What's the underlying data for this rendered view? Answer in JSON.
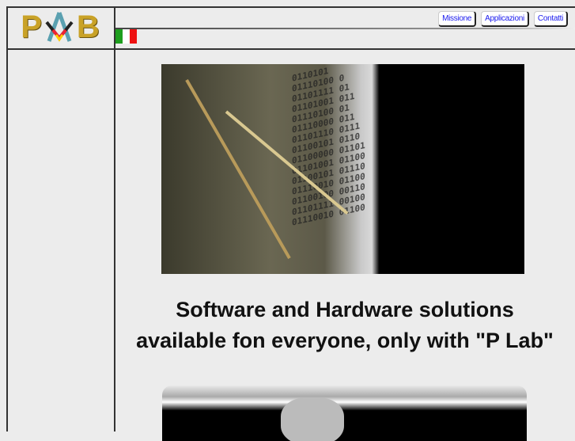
{
  "logo": {
    "text": "PLAB",
    "letters": [
      "P",
      "A",
      "B"
    ]
  },
  "nav": [
    {
      "label": "Missione"
    },
    {
      "label": "Applicazioni"
    },
    {
      "label": "Contatti"
    }
  ],
  "language": {
    "flag": "italy-flag",
    "colors": [
      "#1e9e1e",
      "#ffffff",
      "#ee1111"
    ]
  },
  "hero": {
    "bits": "0110101\n01110100 0\n01101111 01\n01101001 011\n01110100 01\n01110000 011\n01101110 0111\n01100101 0110\n01100000 01101\n01101001 01100\n01100101 01110\n01110010 01100\n01100100 00110\n01101111 00100\n01110010 01100"
  },
  "headline": {
    "line1": "Software and Hardware solutions",
    "line2": "available fon everyone, only with \"P Lab\""
  }
}
